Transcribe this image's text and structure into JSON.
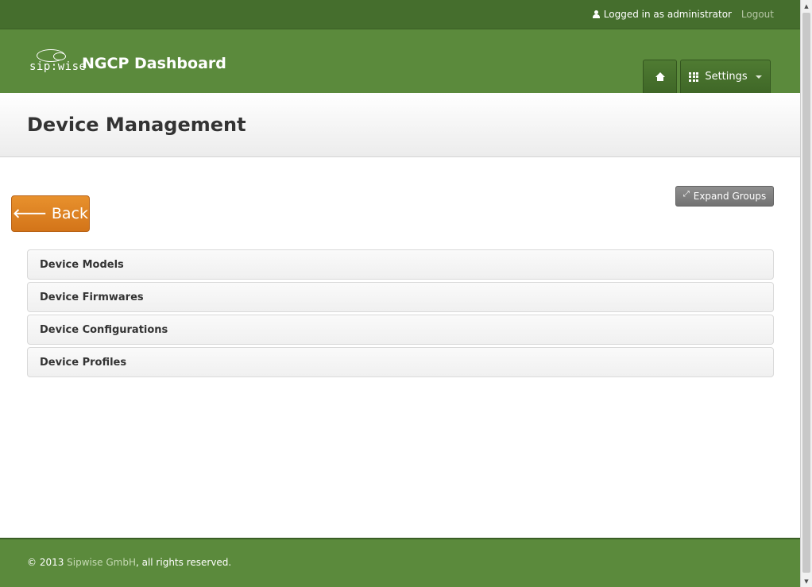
{
  "topbar": {
    "user_text": "Logged in as administrator",
    "logout_label": "Logout"
  },
  "header": {
    "logo_brand": "sip:wise",
    "logo_title": "NGCP Dashboard",
    "nav": {
      "home_icon": "home-icon",
      "settings_label": "Settings"
    }
  },
  "page": {
    "title": "Device Management",
    "back_label": "Back",
    "expand_label": "Expand Groups"
  },
  "groups": [
    {
      "label": "Device Models"
    },
    {
      "label": "Device Firmwares"
    },
    {
      "label": "Device Configurations"
    },
    {
      "label": "Device Profiles"
    }
  ],
  "footer": {
    "copyright_prefix": "© 2013 ",
    "company_link": "Sipwise GmbH",
    "copyright_suffix": ", all rights reserved."
  },
  "colors": {
    "topbar": "#456e2d",
    "header": "#5b8a3c",
    "back_button": "#e08527",
    "expand_button": "#808080"
  }
}
